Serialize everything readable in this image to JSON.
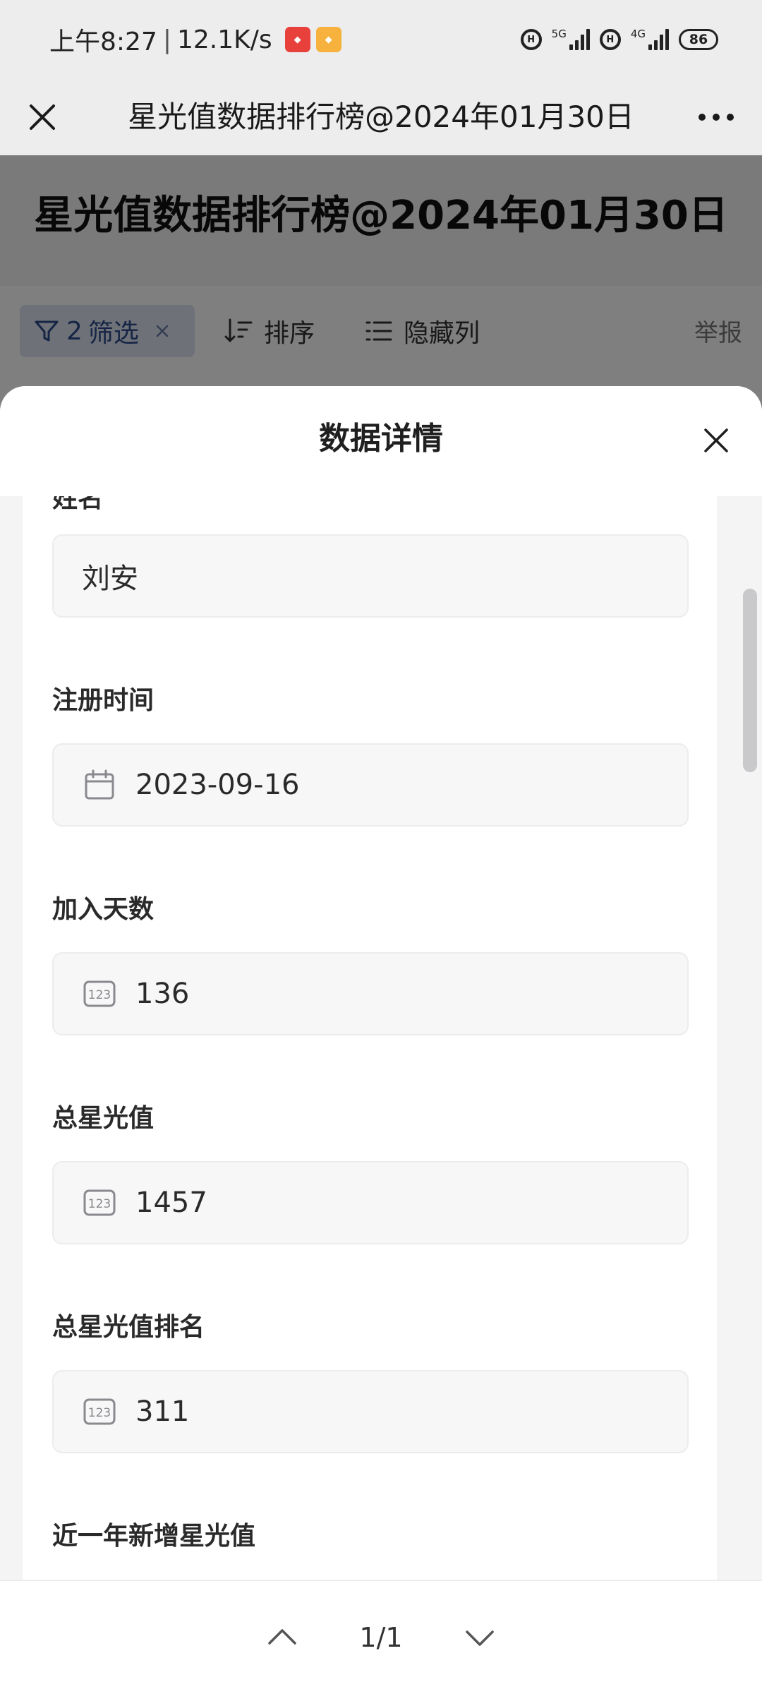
{
  "status_bar": {
    "time": "上午8:27",
    "speed": "12.1K/s",
    "signal_1_label": "5G",
    "signal_2_label": "4G",
    "battery": "86"
  },
  "nav": {
    "title": "星光值数据排行榜@2024年01月30日"
  },
  "page": {
    "title": "星光值数据排行榜@2024年01月30日",
    "filter_count": "2",
    "filter_label": "筛选",
    "sort_label": "排序",
    "hide_cols_label": "隐藏列",
    "report_label": "举报"
  },
  "sheet": {
    "title": "数据详情",
    "partial_label": "姓名",
    "fields": [
      {
        "label": "",
        "value": "刘安",
        "icon": "none"
      },
      {
        "label": "注册时间",
        "value": "2023-09-16",
        "icon": "calendar-icon"
      },
      {
        "label": "加入天数",
        "value": "136",
        "icon": "number-icon"
      },
      {
        "label": "总星光值",
        "value": "1457",
        "icon": "number-icon"
      },
      {
        "label": "总星光值排名",
        "value": "311",
        "icon": "number-icon"
      },
      {
        "label": "近一年新增星光值",
        "value": "",
        "icon": "none"
      }
    ]
  },
  "pager": {
    "text": "1/1"
  },
  "colors": {
    "overlay": "#000000",
    "filter_chip_bg": "#dce3f0",
    "field_bg": "#f7f7f8"
  }
}
